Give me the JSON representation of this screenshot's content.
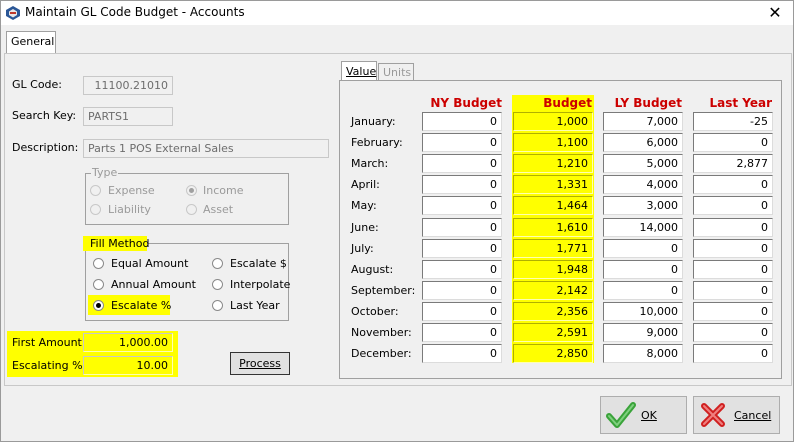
{
  "window": {
    "title": "Maintain GL Code Budget - Accounts",
    "close_glyph": "✕"
  },
  "tabs": {
    "general": "General"
  },
  "fields": {
    "gl_code_label": "GL Code:",
    "gl_code_value": "11100.21010",
    "search_key_label": "Search Key:",
    "search_key_value": "PARTS1",
    "description_label": "Description:",
    "description_value": "Parts 1 POS External Sales"
  },
  "type_group": {
    "legend": "Type",
    "options": [
      "Expense",
      "Income",
      "Liability",
      "Asset"
    ],
    "selected": "Income"
  },
  "fill_method": {
    "legend": "Fill Method",
    "options": [
      "Equal Amount",
      "Escalate $",
      "Annual Amount",
      "Interpolate",
      "Escalate %",
      "Last Year"
    ],
    "selected": "Escalate %"
  },
  "amounts": {
    "first_amount_label": "First Amount:",
    "first_amount_value": "1,000.00",
    "escalating_label": "Escalating %:",
    "escalating_value": "10.00"
  },
  "process_button": "Process",
  "value_tabs": {
    "value": "Value",
    "units": "Units"
  },
  "budget_table": {
    "headers": [
      "NY Budget",
      "Budget",
      "LY Budget",
      "Last Year"
    ],
    "rows": [
      {
        "month": "January:",
        "ny": "0",
        "budget": "1,000",
        "ly": "7,000",
        "last": "-25"
      },
      {
        "month": "February:",
        "ny": "0",
        "budget": "1,100",
        "ly": "6,000",
        "last": "0"
      },
      {
        "month": "March:",
        "ny": "0",
        "budget": "1,210",
        "ly": "5,000",
        "last": "2,877"
      },
      {
        "month": "April:",
        "ny": "0",
        "budget": "1,331",
        "ly": "4,000",
        "last": "0"
      },
      {
        "month": "May:",
        "ny": "0",
        "budget": "1,464",
        "ly": "3,000",
        "last": "0"
      },
      {
        "month": "June:",
        "ny": "0",
        "budget": "1,610",
        "ly": "14,000",
        "last": "0"
      },
      {
        "month": "July:",
        "ny": "0",
        "budget": "1,771",
        "ly": "0",
        "last": "0"
      },
      {
        "month": "August:",
        "ny": "0",
        "budget": "1,948",
        "ly": "0",
        "last": "0"
      },
      {
        "month": "September:",
        "ny": "0",
        "budget": "2,142",
        "ly": "0",
        "last": "0"
      },
      {
        "month": "October:",
        "ny": "0",
        "budget": "2,356",
        "ly": "10,000",
        "last": "0"
      },
      {
        "month": "November:",
        "ny": "0",
        "budget": "2,591",
        "ly": "9,000",
        "last": "0"
      },
      {
        "month": "December:",
        "ny": "0",
        "budget": "2,850",
        "ly": "8,000",
        "last": "0"
      }
    ]
  },
  "footer": {
    "ok": "OK",
    "cancel": "Cancel"
  },
  "colors": {
    "highlight": "#ffff00",
    "header_red": "#cc0000",
    "ok_green": "#3aa33a",
    "cancel_red": "#d02020"
  },
  "icons": {
    "app": "app-logo-icon",
    "ok": "check-icon",
    "cancel": "x-icon"
  }
}
